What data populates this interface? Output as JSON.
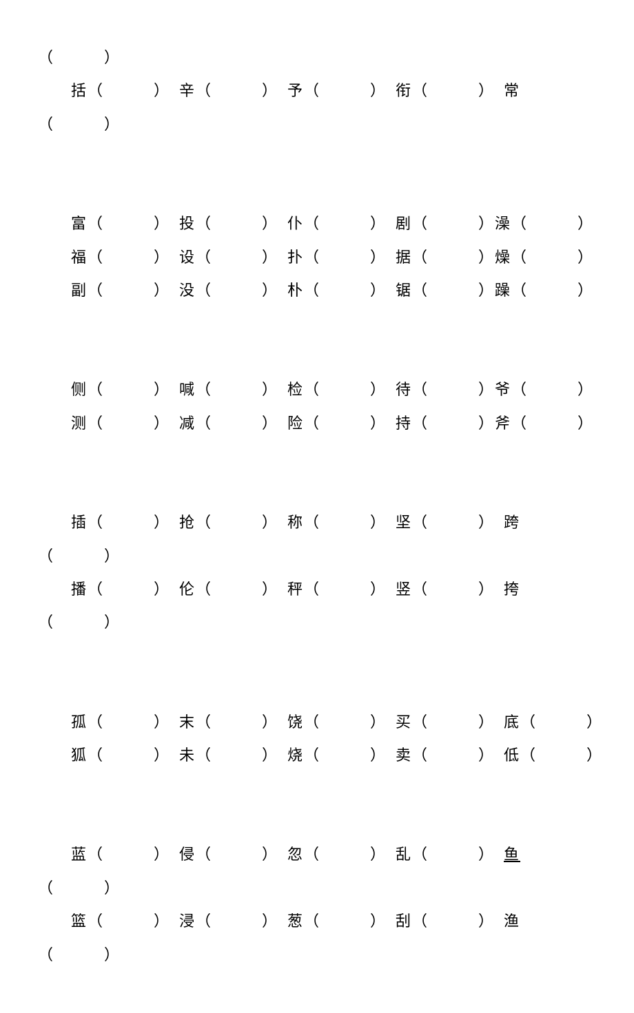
{
  "lines": [
    "（　　　）",
    "　　括（　　　）　辛（　　　）　予（　　　）　衔（　　　）　常",
    "（　　　）",
    "",
    "",
    "　　富（　　　）　投（　　　）　仆（　　　）　剧（　　　）澡（　　　）",
    "　　福（　　　）　设（　　　）　扑（　　　）　据（　　　）燥（　　　）",
    "　　副（　　　）　没（　　　）　朴（　　　）　锯（　　　）躁（　　　）",
    "",
    "",
    "　　侧（　　　）　喊（　　　）　检（　　　）　待（　　　）爷（　　　）",
    "　　测（　　　）　减（　　　）　险（　　　）　持（　　　）斧（　　　）",
    "",
    "",
    "　　插（　　　）　抢（　　　）　称（　　　）　坚（　　　）　跨",
    "（　　　）",
    "　　播（　　　）　伦（　　　）　秤（　　　）　竖（　　　）　挎",
    "（　　　）",
    "",
    "",
    "　　孤（　　　）　末（　　　）　饶（　　　）　买（　　　）　底（　　　）",
    "　　狐（　　　）　未（　　　）　烧（　　　）　卖（　　　）　低（　　　）",
    "",
    "",
    "　　蓝（　　　）　侵（　　　）　忽（　　　）　乱（　　　）　<u>鱼</u>",
    "（　　　）",
    "　　篮（　　　）　浸（　　　）　葱（　　　）　刮（　　　）　渔",
    "（　　　）"
  ]
}
